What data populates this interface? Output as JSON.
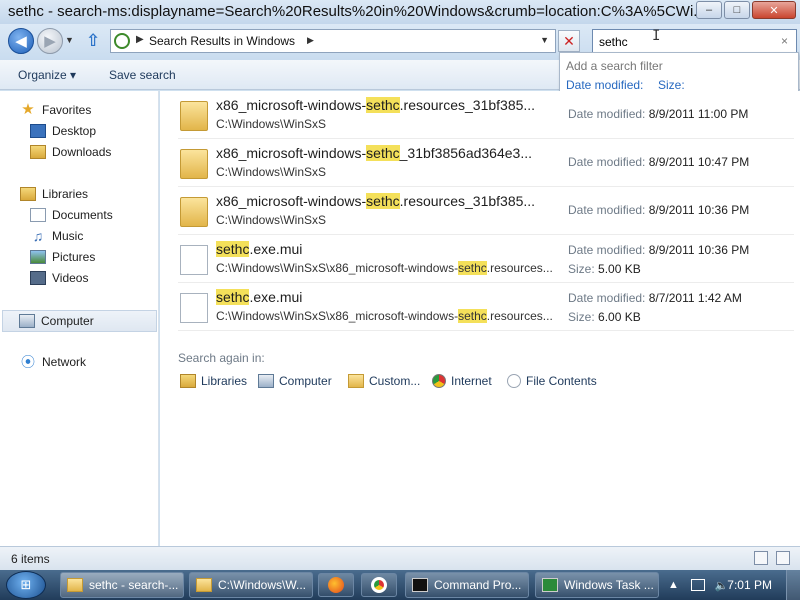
{
  "window": {
    "title": "sethc - search-ms:displayname=Search%20Results%20in%20Windows&crumb=location:C%3A%5CWi...",
    "min_label": "–",
    "max_label": "□",
    "close_label": "✕"
  },
  "nav": {
    "back_glyph": "◀",
    "forward_glyph": "▶",
    "dropdown_glyph": "▼",
    "up_glyph": "⇧",
    "address_text": "Search Results in Windows",
    "address_sep_glyph": "▶",
    "address_chevron": "▶",
    "address_dropdown": "▼",
    "stop_glyph": "✕",
    "search_value": "sethc",
    "search_clear": "×",
    "ibeam": "I"
  },
  "commandbar": {
    "organize": "Organize ▾",
    "save_search": "Save search"
  },
  "search_filter": {
    "heading": "Add a search filter",
    "options": [
      "Date modified:",
      "Size:"
    ]
  },
  "navpane": {
    "favorites": "Favorites",
    "desktop": "Desktop",
    "downloads": "Downloads",
    "libraries": "Libraries",
    "documents": "Documents",
    "music": "Music",
    "pictures": "Pictures",
    "videos": "Videos",
    "computer": "Computer",
    "network": "Network",
    "star_glyph": "★",
    "music_glyph": "♫",
    "network_glyph": "⦿"
  },
  "files": [
    {
      "type": "folder",
      "name_pre": "x86_microsoft-windows-",
      "name_hl": "sethc",
      "name_post": ".resources_31bf385...",
      "path_pre": "C:\\Windows\\WinSxS",
      "path_hl": "",
      "path_post": "",
      "date_label": "Date modified:",
      "date": "8/9/2011 11:00 PM",
      "size_label": "",
      "size": ""
    },
    {
      "type": "folder",
      "name_pre": "x86_microsoft-windows-",
      "name_hl": "sethc",
      "name_post": "_31bf3856ad364e3...",
      "path_pre": "C:\\Windows\\WinSxS",
      "path_hl": "",
      "path_post": "",
      "date_label": "Date modified:",
      "date": "8/9/2011 10:47 PM",
      "size_label": "",
      "size": ""
    },
    {
      "type": "folder",
      "name_pre": "x86_microsoft-windows-",
      "name_hl": "sethc",
      "name_post": ".resources_31bf385...",
      "path_pre": "C:\\Windows\\WinSxS",
      "path_hl": "",
      "path_post": "",
      "date_label": "Date modified:",
      "date": "8/9/2011 10:36 PM",
      "size_label": "",
      "size": ""
    },
    {
      "type": "file",
      "name_pre": "",
      "name_hl": "sethc",
      "name_post": ".exe.mui",
      "path_pre": "C:\\Windows\\WinSxS\\x86_microsoft-windows-",
      "path_hl": "sethc",
      "path_post": ".resources...",
      "date_label": "Date modified:",
      "date": "8/9/2011 10:36 PM",
      "size_label": "Size:",
      "size": "5.00 KB"
    },
    {
      "type": "file",
      "name_pre": "",
      "name_hl": "sethc",
      "name_post": ".exe.mui",
      "path_pre": "C:\\Windows\\WinSxS\\x86_microsoft-windows-",
      "path_hl": "sethc",
      "path_post": ".resources...",
      "date_label": "Date modified:",
      "date": "8/7/2011 1:42 AM",
      "size_label": "Size:",
      "size": "6.00 KB"
    }
  ],
  "search_again": {
    "label": "Search again in:",
    "items": [
      "Libraries",
      "Computer",
      "Custom...",
      "Internet",
      "File Contents"
    ]
  },
  "status": {
    "item_count": "6 items"
  },
  "taskbar": {
    "start_glyph": "⊞",
    "buttons": [
      "sethc - search-...",
      "C:\\Windows\\W...",
      "Command Pro...",
      "Windows Task ..."
    ],
    "tray_arrow": "▲",
    "clock": "7:01 PM"
  }
}
